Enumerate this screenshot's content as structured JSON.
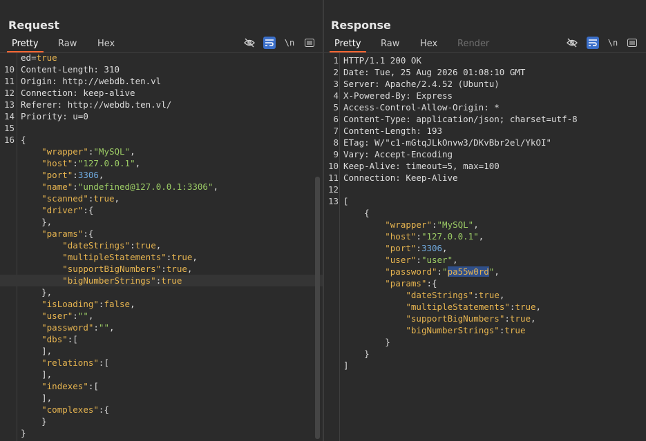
{
  "layout_toggle": {
    "options": [
      "split-horizontal",
      "split-vertical",
      "tabs"
    ],
    "selected": "split-horizontal"
  },
  "request": {
    "title": "Request",
    "tabs": [
      "Pretty",
      "Raw",
      "Hex"
    ],
    "active_tab": "Pretty",
    "newline_label": "\\n",
    "lines": [
      {
        "n": "",
        "t": "ed=true"
      },
      {
        "n": "10",
        "t": "Content-Length: 310"
      },
      {
        "n": "11",
        "t": "Origin: http://webdb.ten.vl"
      },
      {
        "n": "12",
        "t": "Connection: keep-alive"
      },
      {
        "n": "13",
        "t": "Referer: http://webdb.ten.vl/"
      },
      {
        "n": "14",
        "t": "Priority: u=0"
      },
      {
        "n": "15",
        "t": ""
      },
      {
        "n": "16",
        "t": "{"
      },
      {
        "n": "",
        "t": "    \"wrapper\":\"MySQL\","
      },
      {
        "n": "",
        "t": "    \"host\":\"127.0.0.1\","
      },
      {
        "n": "",
        "t": "    \"port\":3306,"
      },
      {
        "n": "",
        "t": "    \"name\":\"undefined@127.0.0.1:3306\","
      },
      {
        "n": "",
        "t": "    \"scanned\":true,"
      },
      {
        "n": "",
        "t": "    \"driver\":{"
      },
      {
        "n": "",
        "t": "    },"
      },
      {
        "n": "",
        "t": "    \"params\":{"
      },
      {
        "n": "",
        "t": "        \"dateStrings\":true,"
      },
      {
        "n": "",
        "t": "        \"multipleStatements\":true,"
      },
      {
        "n": "",
        "t": "        \"supportBigNumbers\":true,"
      },
      {
        "n": "",
        "t": "        \"bigNumberStrings\":true"
      },
      {
        "n": "",
        "t": "    },"
      },
      {
        "n": "",
        "t": "    \"isLoading\":false,"
      },
      {
        "n": "",
        "t": "    \"user\":\"\","
      },
      {
        "n": "",
        "t": "    \"password\":\"\","
      },
      {
        "n": "",
        "t": "    \"dbs\":["
      },
      {
        "n": "",
        "t": "    ],"
      },
      {
        "n": "",
        "t": "    \"relations\":["
      },
      {
        "n": "",
        "t": "    ],"
      },
      {
        "n": "",
        "t": "    \"indexes\":["
      },
      {
        "n": "",
        "t": "    ],"
      },
      {
        "n": "",
        "t": "    \"complexes\":{"
      },
      {
        "n": "",
        "t": "    }"
      },
      {
        "n": "",
        "t": "}"
      }
    ],
    "highlighted_line": 19
  },
  "response": {
    "title": "Response",
    "tabs": [
      "Pretty",
      "Raw",
      "Hex",
      "Render"
    ],
    "active_tab": "Pretty",
    "disabled_tab": "Render",
    "newline_label": "\\n",
    "lines": [
      {
        "n": "1",
        "t": "HTTP/1.1 200 OK"
      },
      {
        "n": "2",
        "t": "Date: Tue, 25 Aug 2026 01:08:10 GMT"
      },
      {
        "n": "3",
        "t": "Server: Apache/2.4.52 (Ubuntu)"
      },
      {
        "n": "4",
        "t": "X-Powered-By: Express"
      },
      {
        "n": "5",
        "t": "Access-Control-Allow-Origin: *"
      },
      {
        "n": "6",
        "t": "Content-Type: application/json; charset=utf-8"
      },
      {
        "n": "7",
        "t": "Content-Length: 193"
      },
      {
        "n": "8",
        "t": "ETag: W/\"c1-mGtqJLkOnvw3/DKvBbr2el/YkOI\""
      },
      {
        "n": "9",
        "t": "Vary: Accept-Encoding"
      },
      {
        "n": "10",
        "t": "Keep-Alive: timeout=5, max=100"
      },
      {
        "n": "11",
        "t": "Connection: Keep-Alive"
      },
      {
        "n": "12",
        "t": ""
      },
      {
        "n": "13",
        "t": "["
      },
      {
        "n": "",
        "t": "    {"
      },
      {
        "n": "",
        "t": "        \"wrapper\":\"MySQL\","
      },
      {
        "n": "",
        "t": "        \"host\":\"127.0.0.1\","
      },
      {
        "n": "",
        "t": "        \"port\":3306,"
      },
      {
        "n": "",
        "t": "        \"user\":\"user\","
      },
      {
        "n": "",
        "t": "        \"password\":\"pa55w0rd\","
      },
      {
        "n": "",
        "t": "        \"params\":{"
      },
      {
        "n": "",
        "t": "            \"dateStrings\":true,"
      },
      {
        "n": "",
        "t": "            \"multipleStatements\":true,"
      },
      {
        "n": "",
        "t": "            \"supportBigNumbers\":true,"
      },
      {
        "n": "",
        "t": "            \"bigNumberStrings\":true"
      },
      {
        "n": "",
        "t": "        }"
      },
      {
        "n": "",
        "t": "    }"
      },
      {
        "n": "",
        "t": "]"
      }
    ],
    "selected_text": "pa55w0rd"
  },
  "colors": {
    "accent_tab": "#ff6633",
    "active_tool": "#3b6fc9",
    "json_key": "#e6b450",
    "json_string": "#9ccc65",
    "json_number": "#6fa8dc"
  }
}
